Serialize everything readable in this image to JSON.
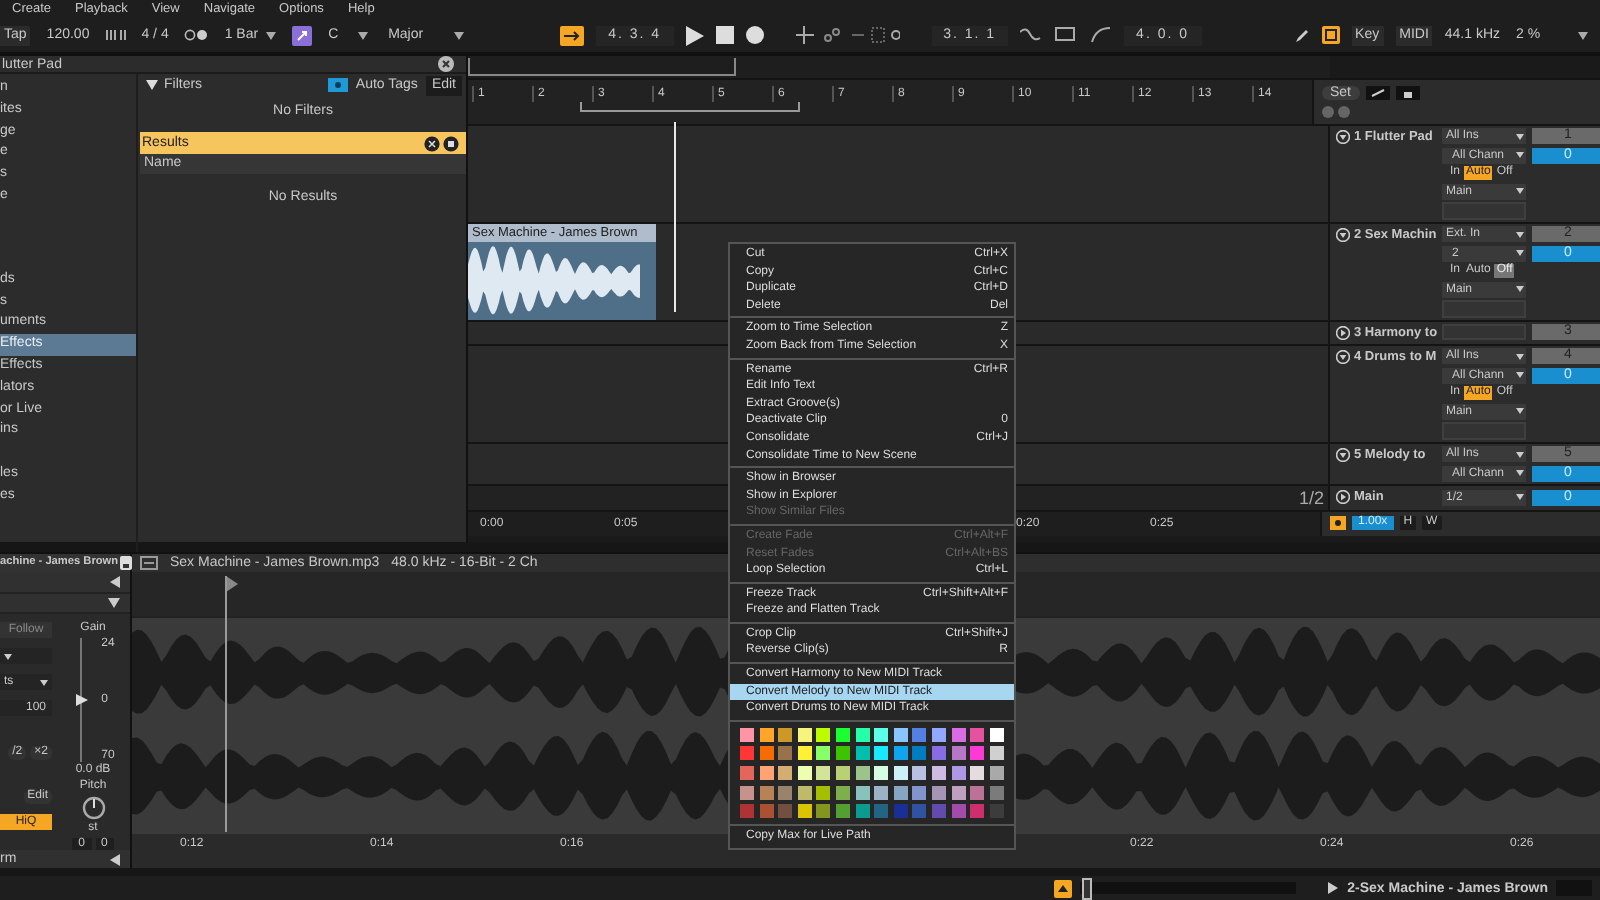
{
  "menu_bar": [
    "Create",
    "Playback",
    "View",
    "Navigate",
    "Options",
    "Help"
  ],
  "transport": {
    "tap": "Tap",
    "tempo": "120.00",
    "signature": "4 / 4",
    "quantize": "1 Bar",
    "key": "C",
    "scale": "Major",
    "position": "4. 3. 4",
    "loop_start": "3. 1. 1",
    "loop_length": "4. 0. 0",
    "key_button": "Key",
    "midi_button": "MIDI",
    "sample_rate": "44.1 kHz",
    "cpu": "2 %"
  },
  "browser": {
    "title": "lutter Pad",
    "groups": [
      {
        "items": [
          {
            "label": "n",
            "selected": false
          },
          {
            "label": "ites",
            "selected": false
          },
          {
            "label": "ge",
            "selected": false
          },
          {
            "label": "e",
            "selected": false
          },
          {
            "label": "s",
            "selected": false
          },
          {
            "label": "e",
            "selected": false
          }
        ]
      },
      {
        "items": [
          {
            "label": "ds",
            "selected": false
          },
          {
            "label": "s",
            "selected": false
          },
          {
            "label": "uments",
            "selected": false
          },
          {
            "label": "Effects",
            "selected": true
          },
          {
            "label": "Effects",
            "selected": false
          },
          {
            "label": "lators",
            "selected": false
          },
          {
            "label": "or Live",
            "selected": false
          },
          {
            "label": "ins",
            "selected": false
          }
        ]
      },
      {
        "items": [
          {
            "label": "les",
            "selected": false
          },
          {
            "label": "es",
            "selected": false
          }
        ]
      }
    ],
    "filters": "Filters",
    "auto_tags": "Auto Tags",
    "edit": "Edit",
    "no_filters": "No Filters",
    "results": "Results",
    "name_column": "Name",
    "no_results": "No Results"
  },
  "arrangement": {
    "bars": [
      "1",
      "2",
      "3",
      "4",
      "5",
      "6",
      "7",
      "8",
      "9",
      "10",
      "11",
      "12",
      "13",
      "14"
    ],
    "times": [
      "0:00",
      "0:05",
      "0:20",
      "0:25"
    ],
    "fraction": "1/2"
  },
  "mixer": {
    "set": "Set",
    "tracks": [
      {
        "name": "1 Flutter Pad",
        "expanded": true,
        "input": "All Ins",
        "channel": "All Chann",
        "monitor": [
          {
            "label": "In",
            "selected": false
          },
          {
            "label": "Auto",
            "selected": true
          },
          {
            "label": "Off",
            "selected": false
          }
        ],
        "output": "Main",
        "number": "1",
        "volume": "0"
      },
      {
        "name": "2 Sex Machin",
        "expanded": true,
        "input": "Ext. In",
        "channel": "2",
        "monitor": [
          {
            "label": "In",
            "selected": false
          },
          {
            "label": "Auto",
            "selected": false
          },
          {
            "label": "Off",
            "selected": true
          }
        ],
        "output": "Main",
        "number": "2",
        "volume": "0",
        "clip": "Sex Machine - James Brown"
      },
      {
        "name": "3 Harmony to",
        "expanded": false,
        "number": "3"
      },
      {
        "name": "4 Drums to M",
        "expanded": true,
        "input": "All Ins",
        "channel": "All Chann",
        "monitor": [
          {
            "label": "In",
            "selected": false
          },
          {
            "label": "Auto",
            "selected": true
          },
          {
            "label": "Off",
            "selected": false
          }
        ],
        "output": "Main",
        "number": "4",
        "volume": "0"
      },
      {
        "name": "5 Melody to",
        "expanded": true,
        "input": "All Ins",
        "channel": "All Chann",
        "number": "5",
        "volume": "0"
      }
    ],
    "main": {
      "name": "Main",
      "output": "1/2",
      "volume": "0"
    },
    "speed": "1.00x",
    "h": "H",
    "w": "W"
  },
  "context_menu": {
    "sections": [
      {
        "items": [
          {
            "label": "Cut",
            "shortcut": "Ctrl+X",
            "disabled": false,
            "selected": false
          },
          {
            "label": "Copy",
            "shortcut": "Ctrl+C",
            "disabled": false,
            "selected": false
          },
          {
            "label": "Duplicate",
            "shortcut": "Ctrl+D",
            "disabled": false,
            "selected": false
          },
          {
            "label": "Delete",
            "shortcut": "Del",
            "disabled": false,
            "selected": false
          }
        ]
      },
      {
        "items": [
          {
            "label": "Zoom to Time Selection",
            "shortcut": "Z",
            "disabled": false,
            "selected": false
          },
          {
            "label": "Zoom Back from Time Selection",
            "shortcut": "X",
            "disabled": false,
            "selected": false
          }
        ]
      },
      {
        "items": [
          {
            "label": "Rename",
            "shortcut": "Ctrl+R",
            "disabled": false,
            "selected": false
          },
          {
            "label": "Edit Info Text",
            "disabled": false,
            "selected": false
          },
          {
            "label": "Extract Groove(s)",
            "disabled": false,
            "selected": false
          },
          {
            "label": "Deactivate Clip",
            "shortcut": "0",
            "disabled": false,
            "selected": false
          },
          {
            "label": "Consolidate",
            "shortcut": "Ctrl+J",
            "disabled": false,
            "selected": false
          },
          {
            "label": "Consolidate Time to New Scene",
            "disabled": false,
            "selected": false
          }
        ]
      },
      {
        "items": [
          {
            "label": "Show in Browser",
            "disabled": false,
            "selected": false
          },
          {
            "label": "Show in Explorer",
            "disabled": false,
            "selected": false
          },
          {
            "label": "Show Similar Files",
            "disabled": true,
            "selected": false
          }
        ]
      },
      {
        "items": [
          {
            "label": "Create Fade",
            "shortcut": "Ctrl+Alt+F",
            "disabled": true,
            "selected": false
          },
          {
            "label": "Reset Fades",
            "shortcut": "Ctrl+Alt+BS",
            "disabled": true,
            "selected": false
          },
          {
            "label": "Loop Selection",
            "shortcut": "Ctrl+L",
            "disabled": false,
            "selected": false
          }
        ]
      },
      {
        "items": [
          {
            "label": "Freeze Track",
            "shortcut": "Ctrl+Shift+Alt+F",
            "disabled": false,
            "selected": false
          },
          {
            "label": "Freeze and Flatten Track",
            "disabled": false,
            "selected": false
          }
        ]
      },
      {
        "items": [
          {
            "label": "Crop Clip",
            "shortcut": "Ctrl+Shift+J",
            "disabled": false,
            "selected": false
          },
          {
            "label": "Reverse Clip(s)",
            "shortcut": "R",
            "disabled": false,
            "selected": false
          }
        ]
      },
      {
        "items": [
          {
            "label": "Convert Harmony to New MIDI Track",
            "disabled": false,
            "selected": false
          },
          {
            "label": "Convert Melody to New MIDI Track",
            "disabled": false,
            "selected": true
          },
          {
            "label": "Convert Drums to New MIDI Track",
            "disabled": false,
            "selected": false
          }
        ]
      }
    ],
    "palette": [
      [
        {
          "color": "#ff94a6"
        },
        {
          "color": "#ffa529"
        },
        {
          "color": "#cc9927"
        },
        {
          "color": "#f7f47c"
        },
        {
          "color": "#bffb00"
        },
        {
          "color": "#1aff2f"
        },
        {
          "color": "#25ffa8"
        },
        {
          "color": "#5cffe8"
        },
        {
          "color": "#8bc5ff"
        },
        {
          "color": "#5480e4"
        },
        {
          "color": "#92a7ff"
        },
        {
          "color": "#d86ce4"
        },
        {
          "color": "#e553a0"
        },
        {
          "color": "#ffffff"
        }
      ],
      [
        {
          "color": "#ff3636"
        },
        {
          "color": "#f66c03"
        },
        {
          "color": "#99724b"
        },
        {
          "color": "#fff034"
        },
        {
          "color": "#87ff67"
        },
        {
          "color": "#3dc300"
        },
        {
          "color": "#00bfaf"
        },
        {
          "color": "#19e9ff"
        },
        {
          "color": "#10a4ee"
        },
        {
          "color": "#007dc0"
        },
        {
          "color": "#886ce4"
        },
        {
          "color": "#b677c6"
        },
        {
          "color": "#ff39d4"
        },
        {
          "color": "#d0d0d0"
        }
      ],
      [
        {
          "color": "#e2675a"
        },
        {
          "color": "#ffa374"
        },
        {
          "color": "#d3ad71"
        },
        {
          "color": "#edffae"
        },
        {
          "color": "#d2e498"
        },
        {
          "color": "#bad074"
        },
        {
          "color": "#9bc48d"
        },
        {
          "color": "#d4fde1"
        },
        {
          "color": "#cdf1f8"
        },
        {
          "color": "#b9c1e3"
        },
        {
          "color": "#cdbbe4"
        },
        {
          "color": "#ae98e5"
        },
        {
          "color": "#e5dce1"
        },
        {
          "color": "#a9a9a9"
        }
      ],
      [
        {
          "color": "#c6928b"
        },
        {
          "color": "#b78256"
        },
        {
          "color": "#99836a"
        },
        {
          "color": "#bfba69"
        },
        {
          "color": "#a6be00"
        },
        {
          "color": "#7db04d"
        },
        {
          "color": "#88c2ba"
        },
        {
          "color": "#9bb3c4"
        },
        {
          "color": "#85a5c2"
        },
        {
          "color": "#8393cc"
        },
        {
          "color": "#a595b5"
        },
        {
          "color": "#bf9fbe"
        },
        {
          "color": "#bc7196"
        },
        {
          "color": "#7b7b7b"
        }
      ],
      [
        {
          "color": "#af3333"
        },
        {
          "color": "#a95131"
        },
        {
          "color": "#724f41"
        },
        {
          "color": "#dbc300"
        },
        {
          "color": "#85961f"
        },
        {
          "color": "#539f31"
        },
        {
          "color": "#0a9c8e"
        },
        {
          "color": "#236384"
        },
        {
          "color": "#1a2f96"
        },
        {
          "color": "#2f52a2"
        },
        {
          "color": "#624bad"
        },
        {
          "color": "#a34bad"
        },
        {
          "color": "#cc2e6e"
        },
        {
          "color": "#3c3c3c"
        }
      ]
    ],
    "footer": "Copy Max for Live Path"
  },
  "clip_detail": {
    "title": "achine - James Brown",
    "follow": {
      "label": "Follow",
      "on": false
    },
    "gain": "Gain",
    "gain_slider": {
      "level": 0.5
    },
    "gain_ticks": [
      "24",
      "0",
      "70"
    ],
    "gain_value": "0.0 dB",
    "warp_mode": "ts",
    "field": "100",
    "halve": "/2",
    "double": "×2",
    "edit": "Edit",
    "hiq": {
      "label": "HiQ",
      "on": true
    },
    "pitch": "Pitch",
    "pitch_unit": "st",
    "pitch_values": [
      "0",
      "0"
    ],
    "section": "rm",
    "file": "Sex Machine - James Brown.mp3",
    "format": "48.0 kHz - 16-Bit - 2 Ch",
    "times": [
      "0:12",
      "0:14",
      "0:16",
      "0:22",
      "0:24",
      "0:26"
    ]
  },
  "status_bar": {
    "zoom": {
      "level": 0.03
    },
    "track": "2-Sex Machine - James Brown"
  }
}
